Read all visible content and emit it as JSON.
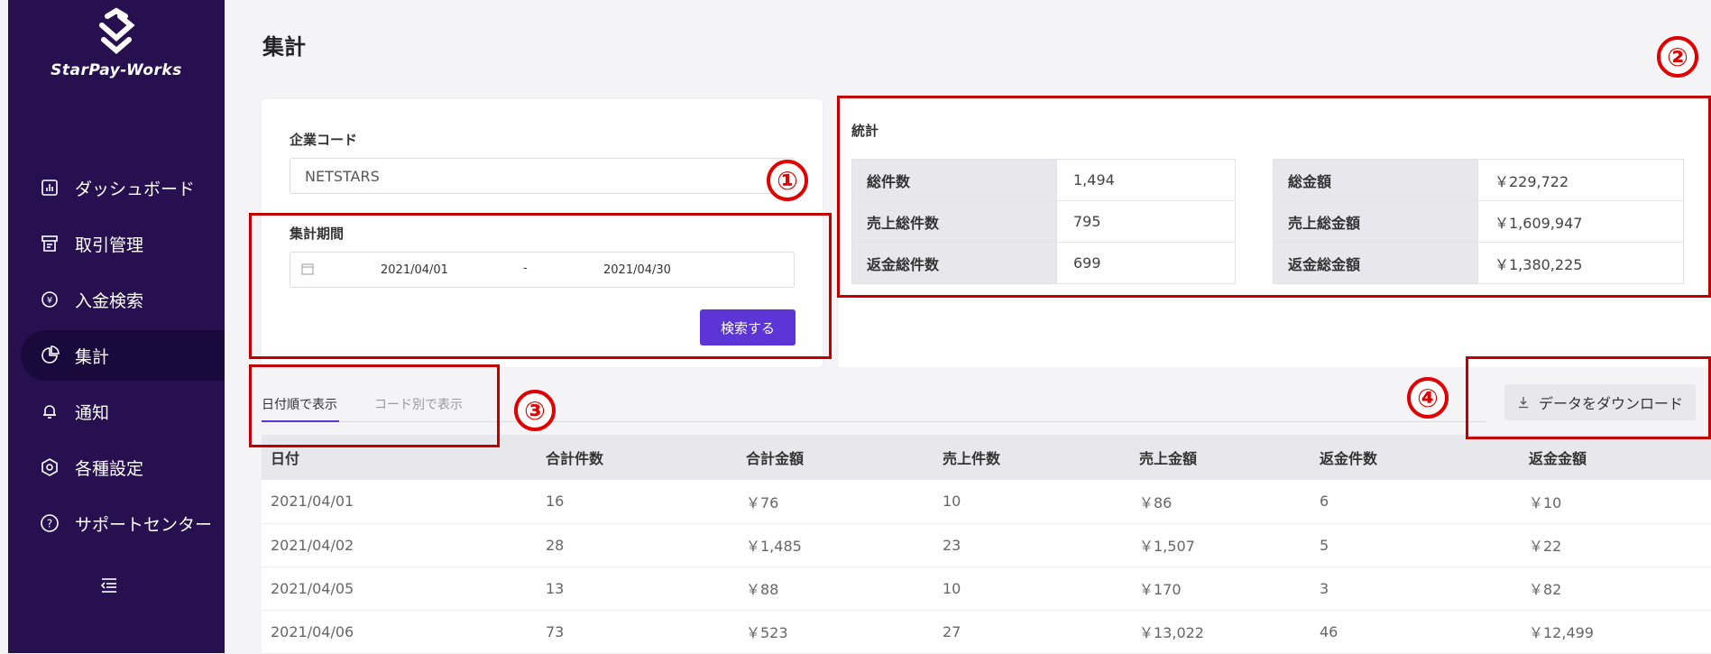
{
  "sidebar": {
    "brand": "StarPay-Works",
    "items": [
      {
        "label": "ダッシュボード",
        "icon": "bar-chart-icon"
      },
      {
        "label": "取引管理",
        "icon": "receipt-icon"
      },
      {
        "label": "入金検索",
        "icon": "yen-circle-icon"
      },
      {
        "label": "集計",
        "icon": "pie-chart-icon",
        "active": true
      },
      {
        "label": "通知",
        "icon": "bell-icon"
      },
      {
        "label": "各種設定",
        "icon": "settings-hex-icon"
      },
      {
        "label": "サポートセンター",
        "icon": "help-circle-icon"
      }
    ],
    "collapse_icon": "menu-collapse-icon"
  },
  "header": {
    "title": "集計"
  },
  "filters": {
    "company_code_label": "企業コード",
    "company_code_value": "NETSTARS",
    "period_label": "集計期間",
    "period_start": "2021/04/01",
    "period_separator": "-",
    "period_end": "2021/04/30",
    "search_button": "検索する"
  },
  "stats": {
    "title": "統計",
    "rows": [
      {
        "k1": "総件数",
        "v1": "1,494",
        "k2": "総金額",
        "v2": "￥229,722"
      },
      {
        "k1": "売上総件数",
        "v1": "795",
        "k2": "売上総金額",
        "v2": "￥1,609,947"
      },
      {
        "k1": "返金総件数",
        "v1": "699",
        "k2": "返金総金額",
        "v2": "￥1,380,225"
      }
    ]
  },
  "tabs": [
    {
      "label": "日付順で表示",
      "active": true
    },
    {
      "label": "コード別で表示",
      "active": false
    }
  ],
  "download_button": "データをダウンロード",
  "table": {
    "headers": [
      "日付",
      "合計件数",
      "合計金額",
      "売上件数",
      "売上金額",
      "返金件数",
      "返金金額"
    ],
    "rows": [
      [
        "2021/04/01",
        "16",
        "￥76",
        "10",
        "￥86",
        "6",
        "￥10"
      ],
      [
        "2021/04/02",
        "28",
        "￥1,485",
        "23",
        "￥1,507",
        "5",
        "￥22"
      ],
      [
        "2021/04/05",
        "13",
        "￥88",
        "10",
        "￥170",
        "3",
        "￥82"
      ],
      [
        "2021/04/06",
        "73",
        "￥523",
        "27",
        "￥13,022",
        "46",
        "￥12,499"
      ]
    ]
  },
  "annotations": [
    "①",
    "②",
    "③",
    "④"
  ],
  "colors": {
    "sidebar": "#26104f",
    "accent": "#5b35d6",
    "annotation": "#e00000"
  }
}
